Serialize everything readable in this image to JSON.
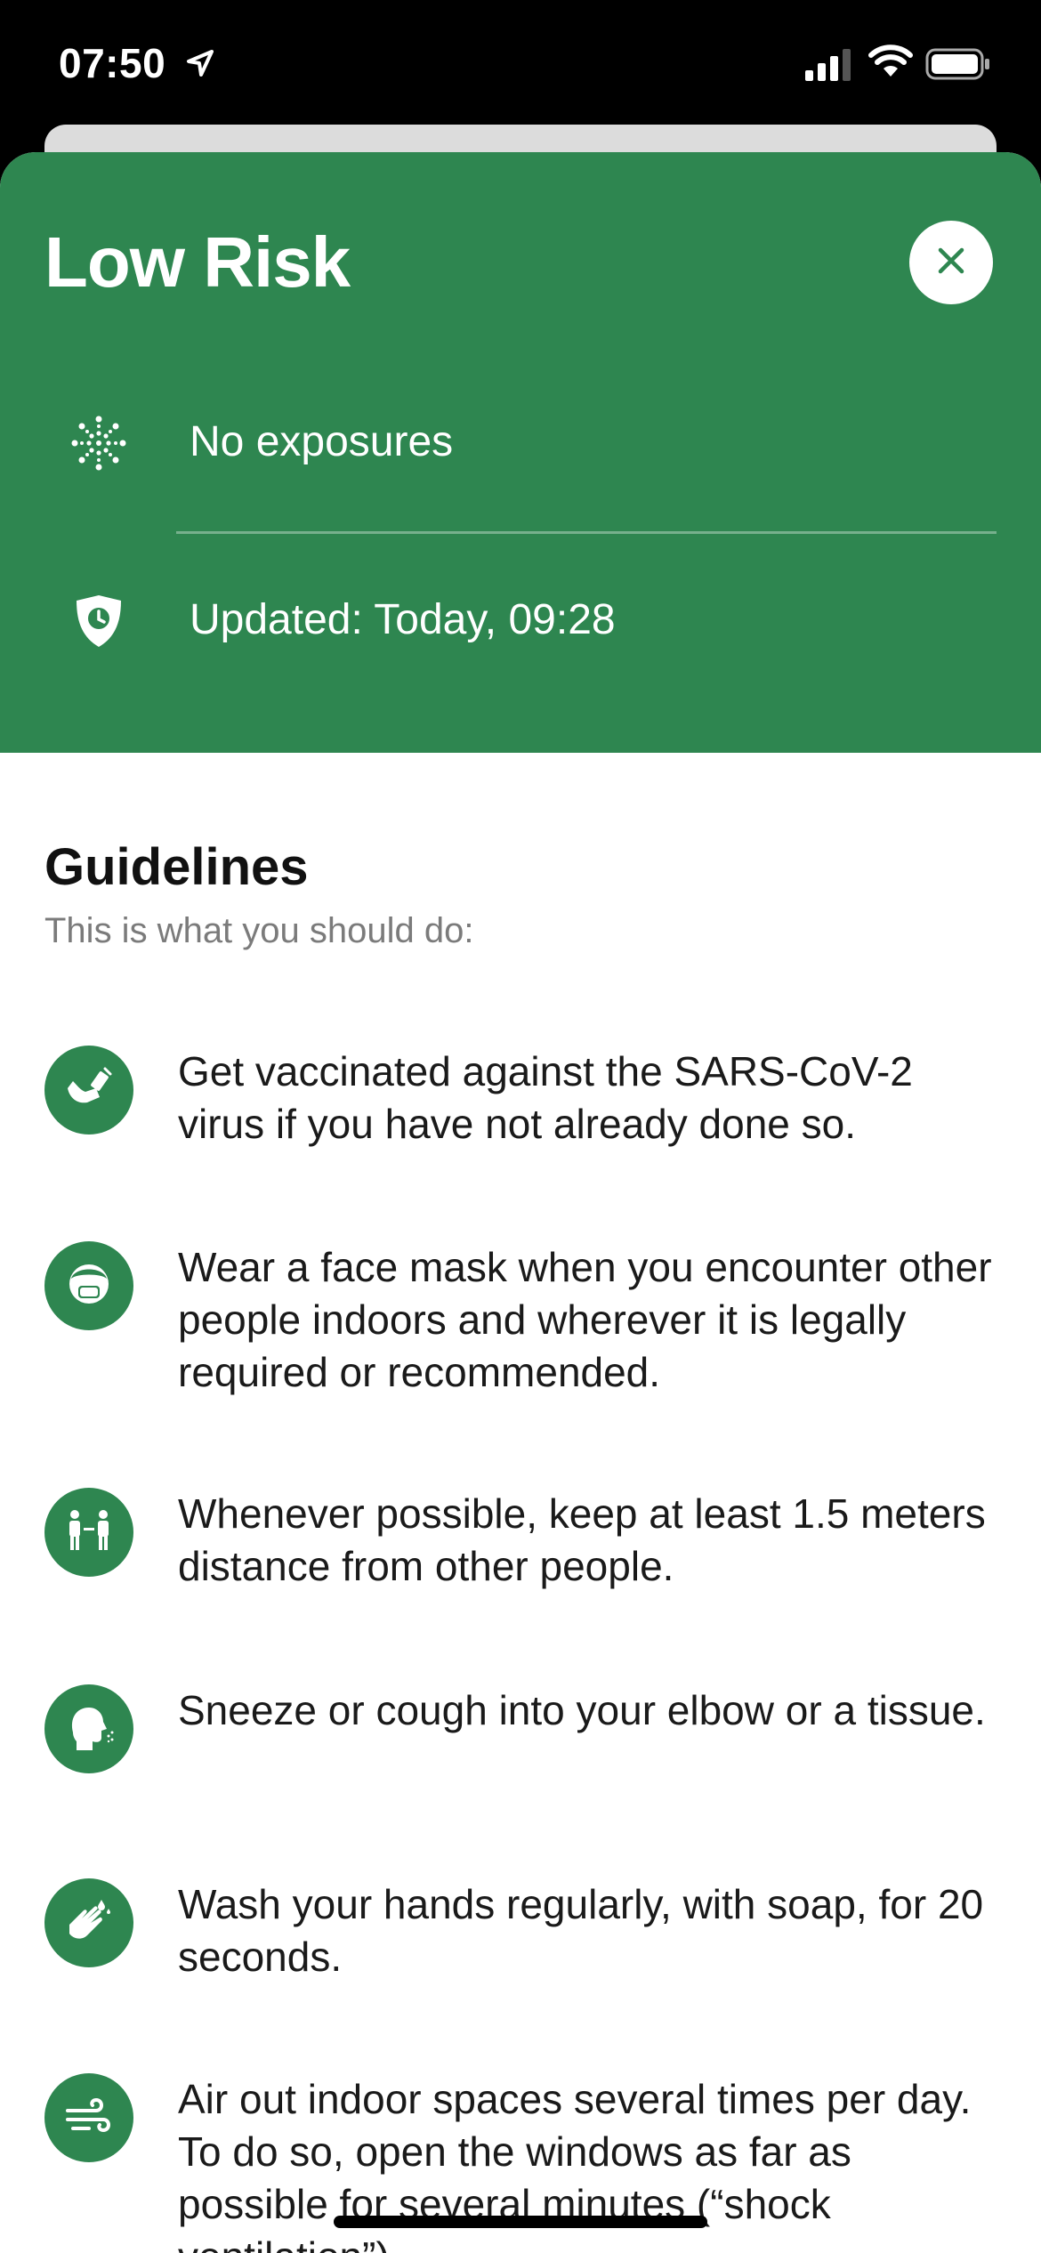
{
  "status_bar": {
    "time": "07:50"
  },
  "risk_card": {
    "title": "Low Risk",
    "accent_color": "#2e8650",
    "rows": [
      {
        "icon": "virus-icon",
        "text": "No exposures"
      },
      {
        "icon": "shield-clock-icon",
        "text": "Updated: Today, 09:28"
      }
    ],
    "close_icon": "close-icon"
  },
  "guidelines": {
    "title": "Guidelines",
    "subtitle": "This is what you should do:",
    "items": [
      {
        "icon": "vaccine-arm-icon",
        "text": "Get vaccinated against the SARS-CoV-2 virus if you have not already done so."
      },
      {
        "icon": "face-mask-icon",
        "text": "Wear a face mask when you encounter other people indoors and wherever it is legally required or recommended."
      },
      {
        "icon": "distance-icon",
        "text": "Whenever possible, keep at least 1.5 meters distance from other people."
      },
      {
        "icon": "sneeze-icon",
        "text": "Sneeze or cough into your elbow or a tissue."
      },
      {
        "icon": "hand-wash-icon",
        "text": "Wash your hands regularly, with soap, for 20 seconds."
      },
      {
        "icon": "ventilation-icon",
        "text": "Air out indoor spaces several times per day. To do so, open the windows as far as possible for several minutes (“shock ventilation”)."
      }
    ]
  }
}
